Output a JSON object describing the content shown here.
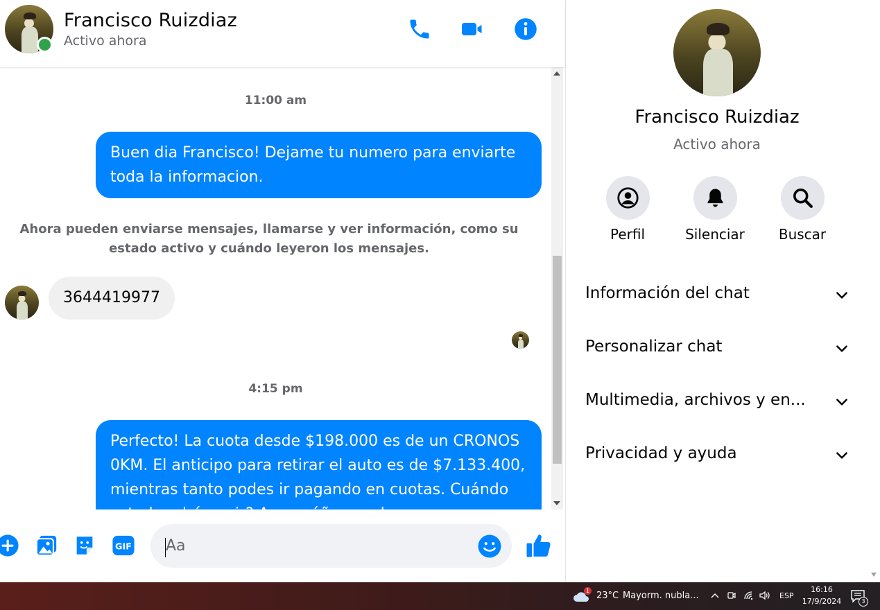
{
  "colors": {
    "accent": "#0084ff",
    "online": "#31a24c",
    "secondary_text": "#65676b"
  },
  "header": {
    "contact_name": "Francisco Ruizdiaz",
    "status": "Activo ahora",
    "icons": [
      "phone-icon",
      "video-camera-icon",
      "info-icon"
    ]
  },
  "messages": {
    "timestamp_1": "11:00 am",
    "outgoing_1": "Buen dia Francisco! Dejame tu numero para enviarte toda la informacion.",
    "system_notice": "Ahora pueden enviarse mensajes, llamarse y ver información, como su estado activo y cuándo leyeron los mensajes.",
    "incoming_1": "3644419977",
    "timestamp_2": "4:15 pm",
    "outgoing_2": "Perfecto! La cuota desde $198.000 es de un CRONOS 0KM. El anticipo para retirar el auto es de $7.133.400, mientras tanto podes ir pagando en cuotas. Cuándo usted podrá venir? Acompáñenos al"
  },
  "composer": {
    "placeholder": "Aa",
    "icons": [
      "plus-icon",
      "photo-icon",
      "sticker-icon",
      "gif-icon",
      "emoji-icon",
      "thumbs-up-icon"
    ],
    "gif_label": "GIF"
  },
  "panel": {
    "name": "Francisco Ruizdiaz",
    "status": "Activo ahora",
    "actions": [
      {
        "label": "Perfil",
        "icon": "profile-icon"
      },
      {
        "label": "Silenciar",
        "icon": "bell-icon"
      },
      {
        "label": "Buscar",
        "icon": "search-icon"
      }
    ],
    "sections": [
      "Información del chat",
      "Personalizar chat",
      "Multimedia, archivos y en...",
      "Privacidad y ayuda"
    ]
  },
  "taskbar": {
    "weather_badge": "1",
    "temperature": "23°C",
    "weather": "Mayorm. nubla...",
    "language": "ESP",
    "time": "16:16",
    "date": "17/9/2024",
    "notification_count": "3"
  }
}
